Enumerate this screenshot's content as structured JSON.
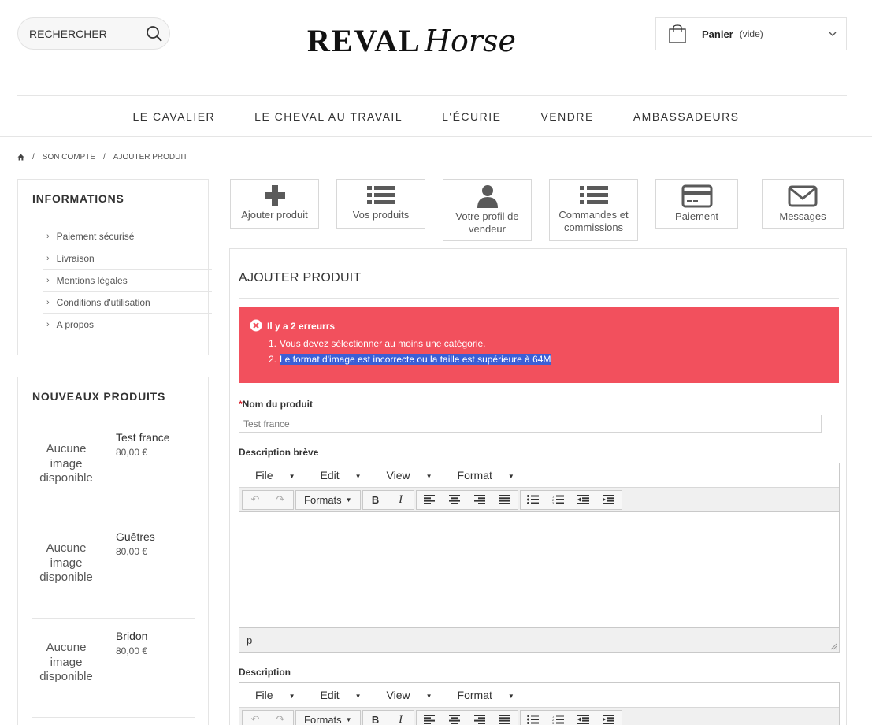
{
  "header": {
    "search": {
      "placeholder": "RECHERCHER",
      "value": ""
    },
    "logo": {
      "main": "REVAL",
      "script": "Horse"
    },
    "cart": {
      "title": "Panier",
      "status": "(vide)"
    }
  },
  "nav": {
    "items": [
      "LE CAVALIER",
      "LE CHEVAL AU TRAVAIL",
      "L'ÉCURIE",
      "VENDRE",
      "AMBASSADEURS"
    ]
  },
  "breadcrumb": {
    "items": [
      "SON COMPTE",
      "AJOUTER PRODUIT"
    ]
  },
  "sidebar": {
    "info_title": "INFORMATIONS",
    "info_links": [
      "Paiement sécurisé",
      "Livraison",
      "Mentions légales",
      "Conditions d'utilisation",
      "A propos"
    ],
    "new_title": "NOUVEAUX PRODUITS",
    "products": [
      {
        "image_text": "Aucune image disponible",
        "name": "Test france",
        "price": "80,00 €"
      },
      {
        "image_text": "Aucune image disponible",
        "name": "Guêtres",
        "price": "80,00 €"
      },
      {
        "image_text": "Aucune image disponible",
        "name": "Bridon",
        "price": "80,00 €"
      }
    ]
  },
  "account_tabs": [
    {
      "label": "Ajouter produit",
      "icon": "plus-icon"
    },
    {
      "label": "Vos produits",
      "icon": "list-icon"
    },
    {
      "label": "Votre profil de vendeur",
      "icon": "user-icon"
    },
    {
      "label": "Commandes et commissions",
      "icon": "list-icon"
    },
    {
      "label": "Paiement",
      "icon": "credit-card-icon"
    },
    {
      "label": "Messages",
      "icon": "envelope-icon"
    }
  ],
  "main": {
    "title": "AJOUTER PRODUIT",
    "error": {
      "title": "Il y a 2 erreurrs",
      "items": [
        "Vous devez sélectionner au moins une catégorie.",
        "Le format d'image est incorrecte ou la taille est supérieure à 64M"
      ]
    },
    "product_name": {
      "required_mark": "*",
      "label": "Nom du produit",
      "value": "Test france"
    },
    "short_description": {
      "label": "Description brève",
      "menu": [
        "File",
        "Edit",
        "View",
        "Format"
      ],
      "formats_label": "Formats",
      "status_path": "p"
    },
    "description": {
      "label": "Description",
      "menu": [
        "File",
        "Edit",
        "View",
        "Format"
      ],
      "formats_label": "Formats"
    }
  },
  "colors": {
    "error_bg": "#f2505d",
    "selection": "#3b5fd6",
    "required": "#d9232e"
  }
}
